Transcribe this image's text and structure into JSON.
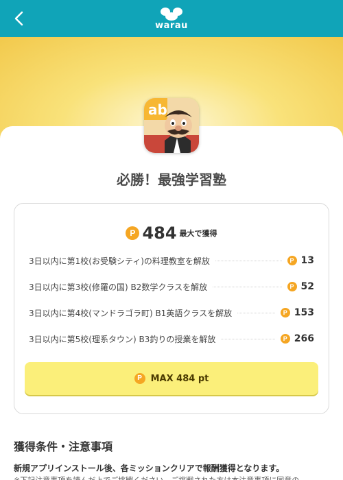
{
  "header": {
    "logo_text": "warau",
    "brand_color": "#10a4b8",
    "back_icon": "chevron-left-icon"
  },
  "app": {
    "title": "必勝！最強学習塾",
    "icon": "app-icon"
  },
  "reward": {
    "max_points": "484",
    "max_suffix": "最大で獲得",
    "coin_symbol": "P",
    "missions": [
      {
        "label": "3日以内に第1校(お受験シティ)の料理教室を解放",
        "points": "13"
      },
      {
        "label": "3日以内に第3校(修羅の国) B2数学クラスを解放",
        "points": "52"
      },
      {
        "label": "3日以内に第4校(マンドラゴラ町) B1英語クラスを解放",
        "points": "153"
      },
      {
        "label": "3日以内に第5校(理系タウン) B3釣りの授業を解放",
        "points": "266"
      }
    ],
    "button_label": "MAX 484 pt",
    "accent_color": "#f5a623",
    "button_color": "#fbef7a"
  },
  "conditions": {
    "title": "獲得条件・注意事項",
    "line1": "新規アプリインストール後、各ミッションクリアで報酬獲得となります。",
    "line2": "※下記注意事項を読んだ上でご挑戦ください。ご挑戦された方は本注意事項に同意の"
  }
}
